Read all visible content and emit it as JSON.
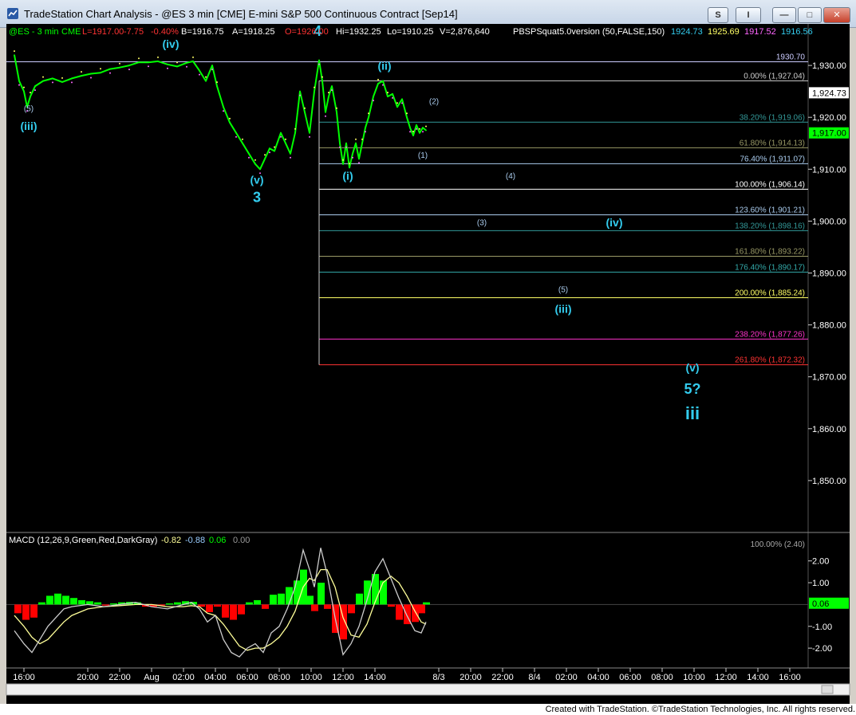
{
  "window": {
    "title": "TradeStation Chart Analysis - @ES 3 min [CME] E-mini S&P 500 Continuous Contract [Sep14]",
    "buttons": {
      "s_label": "S",
      "i_label": "I",
      "minimize": "—",
      "maximize": "□",
      "close": "✕"
    }
  },
  "footer": {
    "credit": "Created with TradeStation. ©TradeStation Technologies, Inc. All rights reserved."
  },
  "colors": {
    "background": "#000000",
    "price": "#00ff00",
    "wave_label": "#33ccee",
    "macd_up": "#00ff00",
    "macd_down": "#ff0000",
    "signal": "#ffff99"
  },
  "chart_data": {
    "type": "line",
    "header": {
      "symbol": "@ES - 3 min",
      "exchange": "CME",
      "last": "L=1917.00",
      "change": "-7.75",
      "change_pct": "-0.40%",
      "bid": "B=1916.75",
      "ask": "A=1918.25",
      "open": "O=1926.00",
      "high": "Hi=1932.25",
      "low": "Lo=1910.25",
      "volume": "V=2,876,640",
      "study": "PBSPSquat5.0version (50,FALSE,150)",
      "study_values": [
        {
          "text": "1924.73",
          "color": "#33ccee"
        },
        {
          "text": "1925.69",
          "color": "#ffff66"
        },
        {
          "text": "1917.52",
          "color": "#ff66ff"
        },
        {
          "text": "1916.56",
          "color": "#33ccee"
        }
      ]
    },
    "price_axis": {
      "range": [
        1840,
        1938
      ],
      "ticks": [
        1850,
        1860,
        1870,
        1880,
        1890,
        1900,
        1910,
        1920,
        1930
      ],
      "tick_labels": [
        "1,850.00",
        "1,860.00",
        "1,870.00",
        "1,880.00",
        "1,890.00",
        "1,900.00",
        "1,910.00",
        "1,920.00",
        "1,930.00"
      ],
      "flags": [
        {
          "value": 1924.73,
          "label": "1,924.73",
          "bg": "#ffffff",
          "fg": "#000000"
        },
        {
          "value": 1917.0,
          "label": "1,917.00",
          "bg": "#00ff00",
          "fg": "#000000"
        }
      ]
    },
    "time_axis": {
      "range": [
        0,
        116
      ],
      "ticks": [
        {
          "t": 0,
          "label": "16:00"
        },
        {
          "t": 4,
          "label": "20:00"
        },
        {
          "t": 6,
          "label": "22:00"
        },
        {
          "t": 8,
          "label": "Aug"
        },
        {
          "t": 10,
          "label": "02:00"
        },
        {
          "t": 12,
          "label": "04:00"
        },
        {
          "t": 14,
          "label": "06:00"
        },
        {
          "t": 16,
          "label": "08:00"
        },
        {
          "t": 18,
          "label": "10:00"
        },
        {
          "t": 20,
          "label": "12:00"
        },
        {
          "t": 22,
          "label": "14:00"
        },
        {
          "t": 26,
          "label": "8/3"
        },
        {
          "t": 28,
          "label": "20:00"
        },
        {
          "t": 30,
          "label": "22:00"
        },
        {
          "t": 32,
          "label": "8/4"
        },
        {
          "t": 34,
          "label": "02:00"
        },
        {
          "t": 36,
          "label": "04:00"
        },
        {
          "t": 38,
          "label": "06:00"
        },
        {
          "t": 40,
          "label": "08:00"
        },
        {
          "t": 42,
          "label": "10:00"
        },
        {
          "t": 44,
          "label": "12:00"
        },
        {
          "t": 46,
          "label": "14:00"
        },
        {
          "t": 48,
          "label": "16:00"
        }
      ]
    },
    "price_series": {
      "name": "@ES",
      "points": [
        [
          -0.6,
          1932
        ],
        [
          -0.3,
          1927
        ],
        [
          0,
          1925
        ],
        [
          0.2,
          1922
        ],
        [
          0.4,
          1924
        ],
        [
          0.7,
          1926
        ],
        [
          1.2,
          1927
        ],
        [
          1.8,
          1927.5
        ],
        [
          2.4,
          1926.8
        ],
        [
          3,
          1927.5
        ],
        [
          3.6,
          1928
        ],
        [
          4.2,
          1928.4
        ],
        [
          4.8,
          1928.6
        ],
        [
          5.4,
          1929.3
        ],
        [
          6,
          1929.6
        ],
        [
          6.6,
          1930
        ],
        [
          7.2,
          1930.6
        ],
        [
          7.8,
          1930.6
        ],
        [
          8.4,
          1930.8
        ],
        [
          9,
          1930.2
        ],
        [
          9.6,
          1929.8
        ],
        [
          10.2,
          1930.5
        ],
        [
          10.6,
          1930.8
        ],
        [
          11,
          1929
        ],
        [
          11.4,
          1927
        ],
        [
          11.8,
          1930
        ],
        [
          12.1,
          1926
        ],
        [
          12.5,
          1922
        ],
        [
          12.9,
          1919
        ],
        [
          13.3,
          1917
        ],
        [
          13.7,
          1915
        ],
        [
          14.1,
          1913
        ],
        [
          14.5,
          1911
        ],
        [
          14.8,
          1910
        ],
        [
          15.1,
          1912
        ],
        [
          15.4,
          1914
        ],
        [
          15.7,
          1913.5
        ],
        [
          16.1,
          1917
        ],
        [
          16.4,
          1915
        ],
        [
          16.7,
          1913
        ],
        [
          17,
          1917
        ],
        [
          17.3,
          1925
        ],
        [
          17.6,
          1921
        ],
        [
          17.9,
          1917
        ],
        [
          18.2,
          1925
        ],
        [
          18.5,
          1931
        ],
        [
          18.7,
          1927
        ],
        [
          18.9,
          1921
        ],
        [
          19.1,
          1924
        ],
        [
          19.3,
          1926
        ],
        [
          19.6,
          1921
        ],
        [
          19.8,
          1915
        ],
        [
          20,
          1911
        ],
        [
          20.2,
          1915
        ],
        [
          20.4,
          1910.3
        ],
        [
          20.6,
          1913
        ],
        [
          20.8,
          1915
        ],
        [
          21,
          1912
        ],
        [
          21.2,
          1915
        ],
        [
          21.4,
          1918
        ],
        [
          21.6,
          1920
        ],
        [
          21.9,
          1924
        ],
        [
          22.2,
          1926.5
        ],
        [
          22.5,
          1927
        ],
        [
          22.8,
          1924
        ],
        [
          23.1,
          1924.5
        ],
        [
          23.4,
          1922
        ],
        [
          23.7,
          1923.5
        ],
        [
          24,
          1920
        ],
        [
          24.2,
          1918
        ],
        [
          24.4,
          1916.5
        ],
        [
          24.6,
          1918.5
        ],
        [
          24.8,
          1917
        ],
        [
          25,
          1918
        ],
        [
          25.2,
          1917.5
        ]
      ]
    },
    "price_wave_labels": [
      {
        "t": 0.3,
        "value": 1921.2,
        "text": "(5)",
        "size": "small"
      },
      {
        "t": 0.3,
        "value": 1917.6,
        "text": "(iii)",
        "size": "medium"
      },
      {
        "t": 9.2,
        "value": 1933.4,
        "text": "(iv)",
        "size": "medium"
      },
      {
        "t": 14.6,
        "value": 1907.2,
        "text": "(v)",
        "size": "medium"
      },
      {
        "t": 14.6,
        "value": 1903.7,
        "text": "3",
        "size": "large"
      },
      {
        "t": 18.4,
        "value": 1935.7,
        "text": "4",
        "size": "large"
      },
      {
        "t": 20.3,
        "value": 1908.0,
        "text": "(i)",
        "size": "medium"
      },
      {
        "t": 22.6,
        "value": 1929.2,
        "text": "(ii)",
        "size": "medium"
      },
      {
        "t": 25.7,
        "value": 1922.6,
        "text": "(2)",
        "size": "small"
      },
      {
        "t": 25.0,
        "value": 1912.2,
        "text": "(1)",
        "size": "small"
      },
      {
        "t": 30.5,
        "value": 1908.2,
        "text": "(4)",
        "size": "small"
      },
      {
        "t": 28.7,
        "value": 1899.2,
        "text": "(3)",
        "size": "small"
      },
      {
        "t": 37.0,
        "value": 1899.0,
        "text": "(iv)",
        "size": "medium"
      },
      {
        "t": 33.8,
        "value": 1886.3,
        "text": "(5)",
        "size": "small"
      },
      {
        "t": 33.8,
        "value": 1882.3,
        "text": "(iii)",
        "size": "medium"
      },
      {
        "t": 41.9,
        "value": 1871.0,
        "text": "(v)",
        "size": "medium"
      },
      {
        "t": 41.9,
        "value": 1866.7,
        "text": "5?",
        "size": "large"
      },
      {
        "t": 41.9,
        "value": 1861.8,
        "text": "iii",
        "size": "xlarge"
      }
    ],
    "fibonacci_levels": [
      {
        "value": 1930.7,
        "label": "1930.70",
        "color": "#ccccff",
        "start": -1
      },
      {
        "value": 1927.04,
        "label": "0.00% (1,927.04)",
        "color": "#cccccc",
        "start": 18.5
      },
      {
        "value": 1919.06,
        "label": "38.20% (1,919.06)",
        "color": "#339999",
        "start": 18.5
      },
      {
        "value": 1914.13,
        "label": "61.80% (1,914.13)",
        "color": "#999966",
        "start": 18.5
      },
      {
        "value": 1911.07,
        "label": "76.40% (1,911.07)",
        "color": "#aaccee",
        "start": 18.5
      },
      {
        "value": 1906.14,
        "label": "100.00% (1,906.14)",
        "color": "#ffffff",
        "start": 18.5
      },
      {
        "value": 1901.21,
        "label": "123.60% (1,901.21)",
        "color": "#aaccee",
        "start": 18.5
      },
      {
        "value": 1898.16,
        "label": "138.20% (1,898.16)",
        "color": "#339999",
        "start": 18.5
      },
      {
        "value": 1893.22,
        "label": "161.80% (1,893.22)",
        "color": "#999966",
        "start": 18.5
      },
      {
        "value": 1890.17,
        "label": "176.40% (1,890.17)",
        "color": "#33aaaa",
        "start": 18.5
      },
      {
        "value": 1885.24,
        "label": "200.00% (1,885.24)",
        "color": "#ffff66",
        "start": 18.5
      },
      {
        "value": 1877.26,
        "label": "238.20% (1,877.26)",
        "color": "#ff33cc",
        "start": 18.5
      },
      {
        "value": 1872.32,
        "label": "261.80% (1,872.32)",
        "color": "#ff3333",
        "start": 18.5
      }
    ],
    "macd": {
      "title": "MACD (12,26,9,Green,Red,DarkGray)",
      "values": [
        {
          "text": "-0.82",
          "color": "#ffff99"
        },
        {
          "text": "-0.88",
          "color": "#99ccff"
        },
        {
          "text": "0.06",
          "color": "#00ff00"
        },
        {
          "text": "0.00",
          "color": "#999999"
        }
      ],
      "range": [
        -2.8,
        2.5
      ],
      "ticks": [
        2,
        1,
        -1,
        -2
      ],
      "tick_labels": [
        "2.00",
        "1.00",
        "-1.00",
        "-2.00"
      ],
      "flag": {
        "value": 0.06,
        "label": "0.06",
        "bg": "#00ff00",
        "fg": "#000000"
      },
      "macd_line": [
        [
          -0.6,
          -1.2
        ],
        [
          0,
          -1.8
        ],
        [
          0.5,
          -2.2
        ],
        [
          1,
          -1.6
        ],
        [
          1.5,
          -1
        ],
        [
          2,
          -0.6
        ],
        [
          2.5,
          -0.2
        ],
        [
          3,
          -0.1
        ],
        [
          4,
          0
        ],
        [
          5,
          -0.1
        ],
        [
          6,
          0
        ],
        [
          7,
          0.1
        ],
        [
          8,
          -0.1
        ],
        [
          9,
          -0.2
        ],
        [
          10,
          0
        ],
        [
          10.5,
          0.1
        ],
        [
          11,
          -0.2
        ],
        [
          11.5,
          -0.8
        ],
        [
          12,
          -0.5
        ],
        [
          12.5,
          -1.6
        ],
        [
          13,
          -2.2
        ],
        [
          13.5,
          -2.4
        ],
        [
          14,
          -2
        ],
        [
          14.5,
          -1.8
        ],
        [
          15,
          -2.2
        ],
        [
          15.5,
          -1.3
        ],
        [
          16,
          -1
        ],
        [
          16.5,
          -0.2
        ],
        [
          17,
          0.8
        ],
        [
          17.5,
          2.5
        ],
        [
          17.9,
          1.6
        ],
        [
          18.2,
          0.8
        ],
        [
          18.6,
          2.6
        ],
        [
          19,
          1.4
        ],
        [
          19.5,
          -0.6
        ],
        [
          20,
          -2.3
        ],
        [
          20.5,
          -1.8
        ],
        [
          21,
          -1
        ],
        [
          21.5,
          0.2
        ],
        [
          22,
          1.5
        ],
        [
          22.5,
          2.1
        ],
        [
          23,
          1.2
        ],
        [
          23.5,
          0.3
        ],
        [
          24,
          -0.5
        ],
        [
          24.5,
          -1.2
        ],
        [
          24.9,
          -1.3
        ],
        [
          25.2,
          -0.8
        ]
      ],
      "signal_line": [
        [
          -0.6,
          -0.5
        ],
        [
          0,
          -1
        ],
        [
          0.5,
          -1.5
        ],
        [
          1,
          -1.8
        ],
        [
          1.5,
          -1.6
        ],
        [
          2,
          -1.2
        ],
        [
          2.5,
          -0.8
        ],
        [
          3,
          -0.5
        ],
        [
          4,
          -0.2
        ],
        [
          5,
          -0.1
        ],
        [
          6,
          -0.05
        ],
        [
          7,
          0
        ],
        [
          8,
          0
        ],
        [
          9,
          -0.1
        ],
        [
          10,
          -0.1
        ],
        [
          10.5,
          -0.05
        ],
        [
          11,
          -0.1
        ],
        [
          11.5,
          -0.4
        ],
        [
          12,
          -0.5
        ],
        [
          12.5,
          -0.9
        ],
        [
          13,
          -1.4
        ],
        [
          13.5,
          -1.9
        ],
        [
          14,
          -2.1
        ],
        [
          14.5,
          -2
        ],
        [
          15,
          -2
        ],
        [
          15.5,
          -1.8
        ],
        [
          16,
          -1.5
        ],
        [
          16.5,
          -1
        ],
        [
          17,
          -0.3
        ],
        [
          17.5,
          0.8
        ],
        [
          17.9,
          1.2
        ],
        [
          18.2,
          1.1
        ],
        [
          18.6,
          1.6
        ],
        [
          19,
          1.6
        ],
        [
          19.5,
          0.8
        ],
        [
          20,
          -0.6
        ],
        [
          20.5,
          -1.4
        ],
        [
          21,
          -1.5
        ],
        [
          21.5,
          -0.9
        ],
        [
          22,
          0.1
        ],
        [
          22.5,
          1
        ],
        [
          23,
          1.3
        ],
        [
          23.5,
          1
        ],
        [
          24,
          0.4
        ],
        [
          24.5,
          -0.3
        ],
        [
          24.9,
          -0.8
        ],
        [
          25.2,
          -0.9
        ]
      ],
      "histogram": [
        [
          -0.4,
          -0.4
        ],
        [
          0.1,
          -0.7
        ],
        [
          0.6,
          -0.6
        ],
        [
          1.1,
          0.1
        ],
        [
          1.6,
          0.4
        ],
        [
          2.1,
          0.5
        ],
        [
          2.6,
          0.4
        ],
        [
          3.1,
          0.3
        ],
        [
          3.6,
          0.2
        ],
        [
          4.1,
          0.15
        ],
        [
          4.6,
          0.1
        ],
        [
          5.1,
          -0.05
        ],
        [
          5.6,
          0.05
        ],
        [
          6.1,
          0.1
        ],
        [
          6.6,
          0.12
        ],
        [
          7.1,
          0.1
        ],
        [
          7.6,
          -0.1
        ],
        [
          8.1,
          -0.1
        ],
        [
          8.6,
          -0.05
        ],
        [
          9.1,
          0.05
        ],
        [
          9.6,
          0.1
        ],
        [
          10.1,
          0.15
        ],
        [
          10.6,
          0.12
        ],
        [
          11.1,
          -0.1
        ],
        [
          11.6,
          -0.35
        ],
        [
          12.1,
          -0.1
        ],
        [
          12.6,
          -0.6
        ],
        [
          13.1,
          -0.7
        ],
        [
          13.6,
          -0.45
        ],
        [
          14.1,
          0.1
        ],
        [
          14.6,
          0.2
        ],
        [
          15.1,
          -0.2
        ],
        [
          15.6,
          0.45
        ],
        [
          16.1,
          0.5
        ],
        [
          16.6,
          0.8
        ],
        [
          17.1,
          1.1
        ],
        [
          17.5,
          1.6
        ],
        [
          17.9,
          0.4
        ],
        [
          18.2,
          -0.3
        ],
        [
          18.6,
          1.0
        ],
        [
          19,
          -0.2
        ],
        [
          19.5,
          -1.3
        ],
        [
          20,
          -1.6
        ],
        [
          20.5,
          -0.4
        ],
        [
          21,
          0.5
        ],
        [
          21.5,
          1.1
        ],
        [
          22,
          1.4
        ],
        [
          22.5,
          1.1
        ],
        [
          23,
          -0.1
        ],
        [
          23.5,
          -0.7
        ],
        [
          24,
          -0.9
        ],
        [
          24.5,
          -0.8
        ],
        [
          24.9,
          -0.4
        ],
        [
          25.2,
          0.1
        ]
      ],
      "label_overlap": "100.00% (2.40)"
    }
  }
}
